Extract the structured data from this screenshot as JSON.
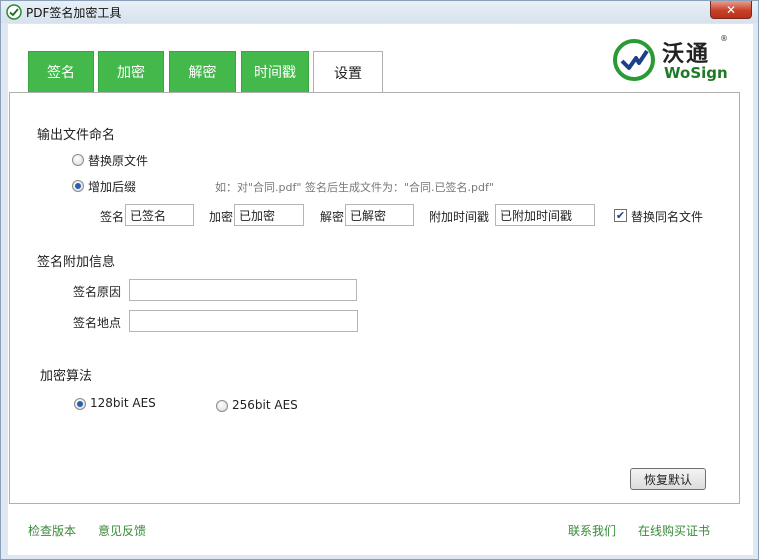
{
  "window": {
    "title": "PDF签名加密工具",
    "close_label": "✕"
  },
  "tabs": [
    {
      "label": "签名",
      "active": false
    },
    {
      "label": "加密",
      "active": false
    },
    {
      "label": "解密",
      "active": false
    },
    {
      "label": "时间戳",
      "active": false
    },
    {
      "label": "设置",
      "active": true
    }
  ],
  "logo": {
    "cn": "沃通",
    "en": "WoSign",
    "reg": "®"
  },
  "output_naming": {
    "heading": "输出文件命名",
    "replace_label": "替换原文件",
    "suffix_label": "增加后缀",
    "suffix_selected": true,
    "example_hint": "如：对\"合同.pdf\" 签名后生成文件为：\"合同.已签名.pdf\"",
    "fields": {
      "sign_label": "签名",
      "sign_value": "已签名",
      "encrypt_label": "加密",
      "encrypt_value": "已加密",
      "decrypt_label": "解密",
      "decrypt_value": "已解密",
      "timestamp_label": "附加时间戳",
      "timestamp_value": "已附加时间戳"
    },
    "replace_same_name_label": "替换同名文件",
    "replace_same_name_checked": true
  },
  "sign_info": {
    "heading": "签名附加信息",
    "reason_label": "签名原因",
    "reason_value": "",
    "location_label": "签名地点",
    "location_value": ""
  },
  "encryption": {
    "heading": "加密算法",
    "aes128_label": "128bit AES",
    "aes256_label": "256bit AES",
    "selected": "128bit AES"
  },
  "restore_button": "恢复默认",
  "footer": {
    "check_version": "检查版本",
    "feedback": "意见反馈",
    "contact": "联系我们",
    "buy_cert": "在线购买证书"
  },
  "colors": {
    "tab_green": "#44b94b",
    "link_green": "#3a8a3a",
    "logo_green": "#1f7a27"
  }
}
